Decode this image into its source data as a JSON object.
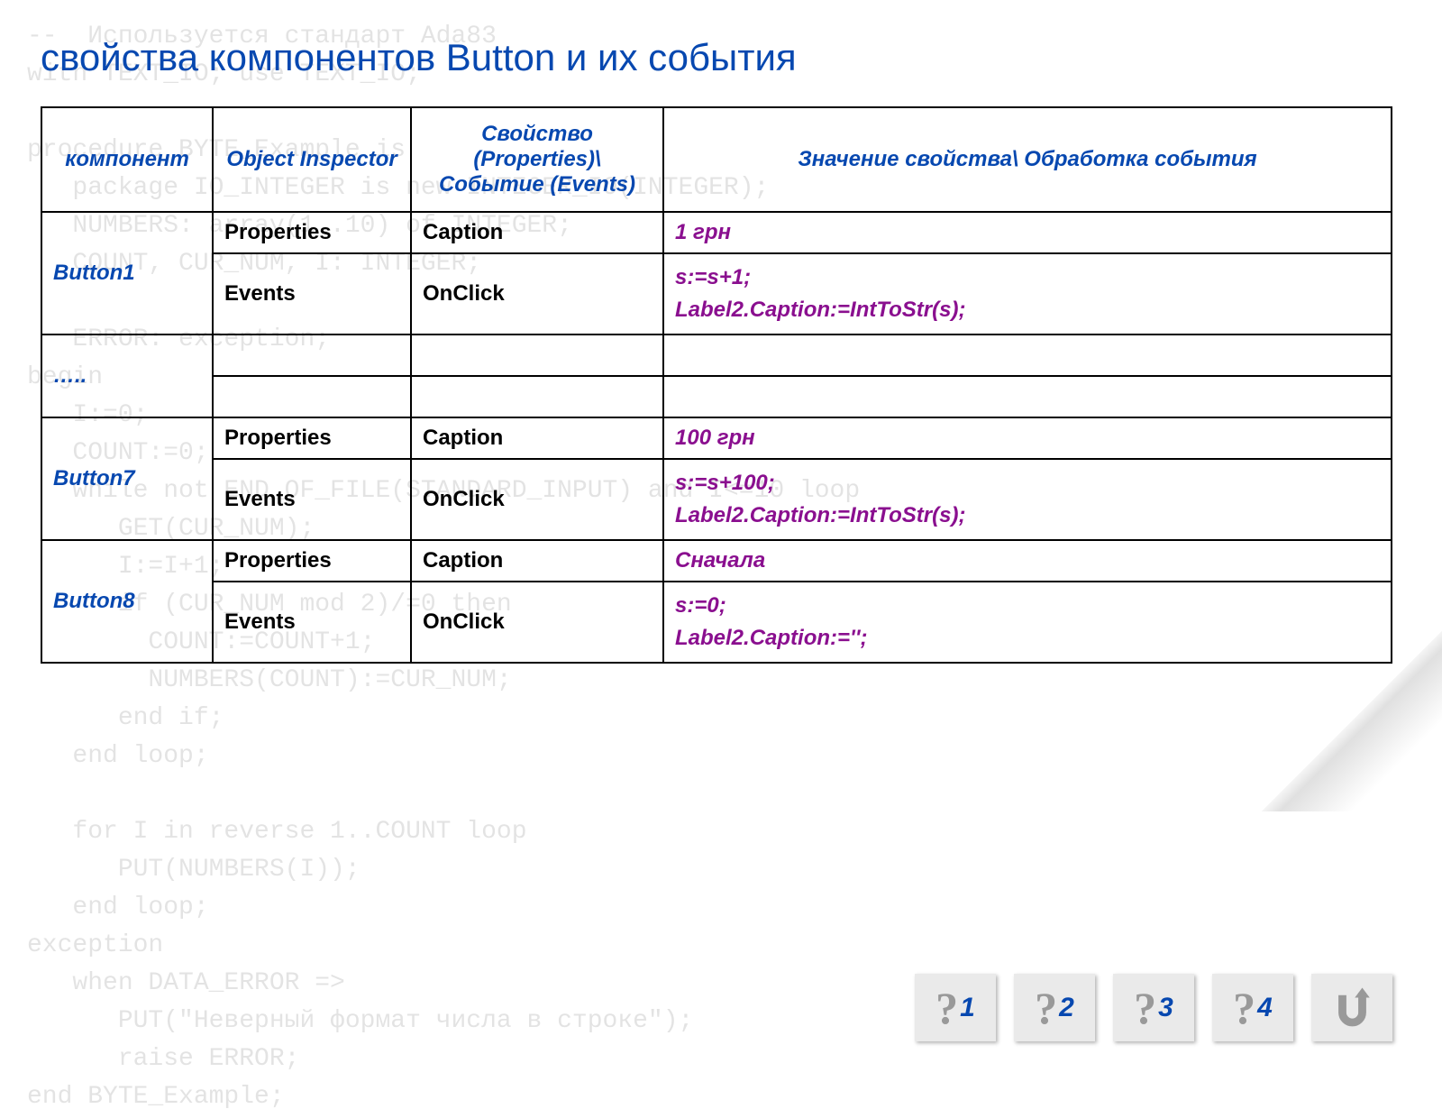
{
  "bg_code": "--  Используется стандарт Ada83\nwith TEXT_IO; use TEXT_IO;\n\nprocedure BYTE_Example is\n   package IO_INTEGER is new INTEGER_IO(INTEGER);\n   NUMBERS: array(1..10) of INTEGER;\n   COUNT, CUR_NUM, I: INTEGER;\n\n   ERROR: exception;\nbegin\n   I:=0;\n   COUNT:=0;\n   while not END_OF_FILE(STANDARD_INPUT) and I<=10 loop\n      GET(CUR_NUM);\n      I:=I+1;\n      if (CUR_NUM mod 2)/=0 then\n        COUNT:=COUNT+1;\n        NUMBERS(COUNT):=CUR_NUM;\n      end if;\n   end loop;\n\n   for I in reverse 1..COUNT loop\n      PUT(NUMBERS(I));\n   end loop;\nexception\n   when DATA_ERROR =>\n      PUT(\"Неверный формат числа в строке\");\n      raise ERROR;\nend BYTE_Example;",
  "title": "свойства компонентов Button и их события",
  "headers": {
    "component": "компонент",
    "inspector": "Object Inspector",
    "prop_event": "Свойство (Properties)\\ Событие (Events)",
    "value": "Значение свойства\\ Обработка события"
  },
  "labels": {
    "properties": "Properties",
    "events": "Events",
    "caption": "Caption",
    "onclick": "OnClick"
  },
  "rows": [
    {
      "component": "Button1",
      "caption_value": "1 грн",
      "onclick_value": "s:=s+1;\n Label2.Caption:=IntToStr(s);"
    }
  ],
  "ellipsis": "…..",
  "rows2": [
    {
      "component": "Button7",
      "caption_value": "100 грн",
      "onclick_value": "s:=s+100;\n Label2.Caption:=IntToStr(s);"
    },
    {
      "component": "Button8",
      "caption_value": "Сначала",
      "onclick_value": "s:=0;\n Label2.Caption:='';"
    }
  ],
  "nav": {
    "items": [
      "1",
      "2",
      "3",
      "4"
    ]
  }
}
